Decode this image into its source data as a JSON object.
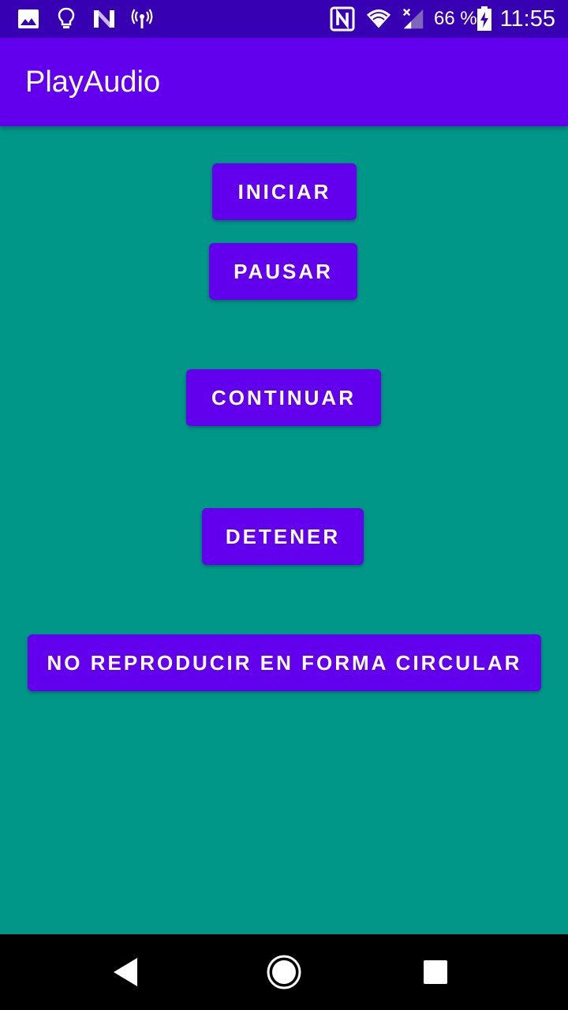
{
  "status_bar": {
    "battery_percent": "66 %",
    "time": "11:55",
    "left_icons": [
      "gallery-icon",
      "lightbulb-icon",
      "n-logo-icon",
      "broadcast-icon"
    ],
    "right_icons": [
      "nfc-icon",
      "wifi-icon",
      "cell-signal-icon",
      "battery-charging-icon"
    ]
  },
  "app_bar": {
    "title": "PlayAudio"
  },
  "buttons": {
    "start": "INICIAR",
    "pause": "PAUSAR",
    "resume": "CONTINUAR",
    "stop": "DETENER",
    "loop": "NO REPRODUCIR EN FORMA CIRCULAR"
  },
  "colors": {
    "background": "#009688",
    "primary": "#6200EE",
    "primary_dark": "#3700B3",
    "nav_bar": "#000000"
  },
  "nav_bar": {
    "icons": [
      "back-icon",
      "home-icon",
      "recents-icon"
    ]
  }
}
